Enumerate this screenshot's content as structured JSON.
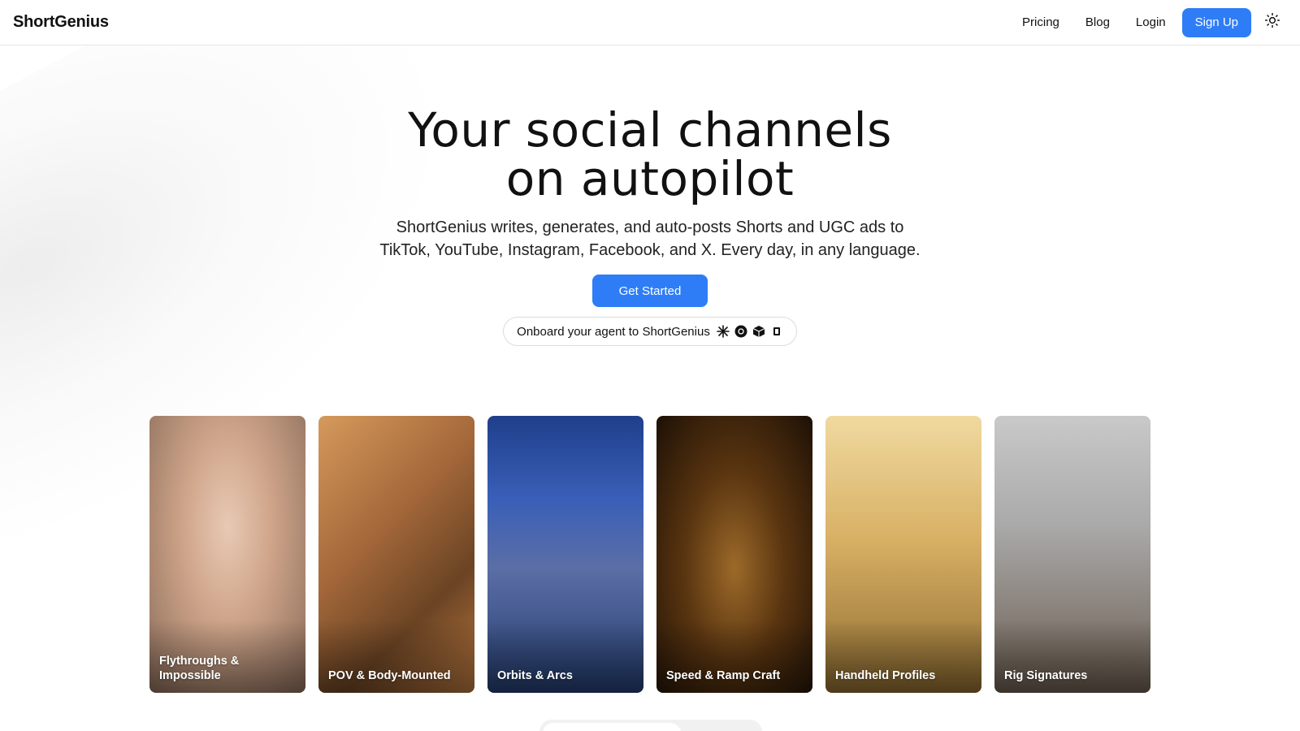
{
  "header": {
    "brand": "ShortGenius",
    "nav": [
      {
        "label": "Pricing"
      },
      {
        "label": "Blog"
      },
      {
        "label": "Login"
      }
    ],
    "signup_label": "Sign Up",
    "theme_icon": "sun-icon"
  },
  "hero": {
    "title_line1": "Your social channels",
    "title_line2": "on autopilot",
    "subtitle_line1": "ShortGenius writes, generates, and auto-posts Shorts and UGC ads to",
    "subtitle_line2": "TikTok, YouTube, Instagram, Facebook, and X. Every day, in any language.",
    "cta_label": "Get Started",
    "agent_label": "Onboard your agent to ShortGenius",
    "agent_icons": [
      "asterisk-spark-icon",
      "openai-icon",
      "cube-icon",
      "square-icon"
    ]
  },
  "cards": [
    {
      "label": "Flythroughs & Impossible"
    },
    {
      "label": "POV & Body-Mounted"
    },
    {
      "label": "Orbits & Arcs"
    },
    {
      "label": "Speed & Ramp Craft"
    },
    {
      "label": "Handheld Profiles"
    },
    {
      "label": "Rig Signatures"
    }
  ],
  "colors": {
    "accent": "#2f7df6",
    "text": "#111111",
    "border": "#e6e6e6"
  }
}
